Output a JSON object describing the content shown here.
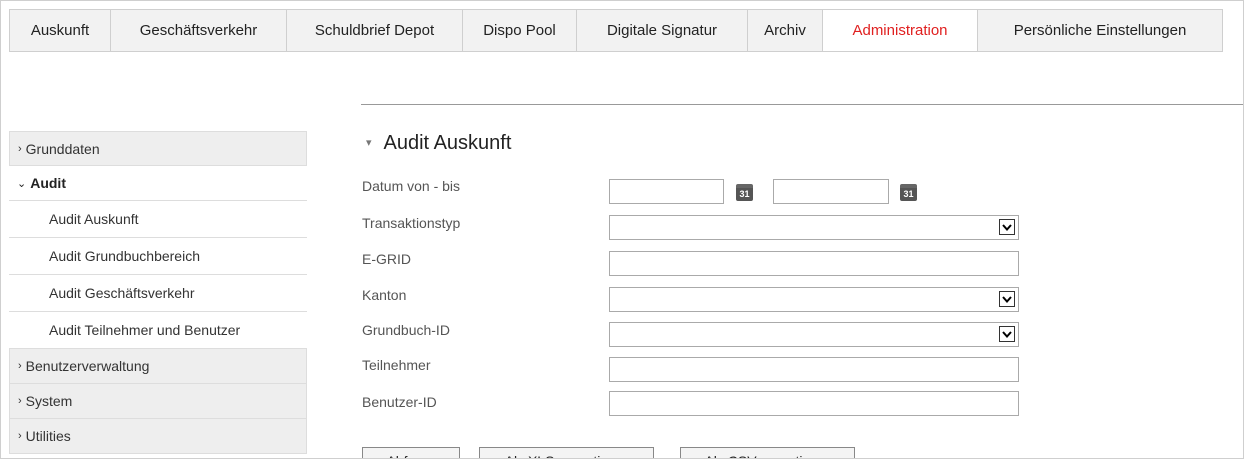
{
  "tabs": [
    {
      "label": "Auskunft"
    },
    {
      "label": "Geschäftsverkehr"
    },
    {
      "label": "Schuldbrief Depot"
    },
    {
      "label": "Dispo Pool"
    },
    {
      "label": "Digitale Signatur"
    },
    {
      "label": "Archiv"
    },
    {
      "label": "Administration",
      "active": true
    },
    {
      "label": "Persönliche Einstellungen"
    }
  ],
  "sidebar": {
    "grunddaten": "Grunddaten",
    "audit": "Audit",
    "audit_items": [
      "Audit Auskunft",
      "Audit Grundbuchbereich",
      "Audit Geschäftsverkehr",
      "Audit Teilnehmer und Benutzer"
    ],
    "benutzerverwaltung": "Benutzerverwaltung",
    "system": "System",
    "utilities": "Utilities",
    "chevron_right": "›",
    "chevron_down": "⌄"
  },
  "form": {
    "title": "Audit Auskunft",
    "collapse_glyph": "▾",
    "labels": {
      "datum": "Datum von - bis",
      "transaktionstyp": "Transaktionstyp",
      "egrid": "E-GRID",
      "kanton": "Kanton",
      "grundbuch_id": "Grundbuch-ID",
      "teilnehmer": "Teilnehmer",
      "benutzer_id": "Benutzer-ID"
    },
    "values": {
      "datum_von": "",
      "datum_bis": "",
      "transaktionstyp": "",
      "egrid": "",
      "kanton": "",
      "grundbuch_id": "",
      "teilnehmer": "",
      "benutzer_id": ""
    },
    "calendar_day": "31"
  },
  "buttons": {
    "abfrage": "Abfrage",
    "xls": "Als XLS exportieren",
    "csv": "Als CSV exportieren"
  }
}
